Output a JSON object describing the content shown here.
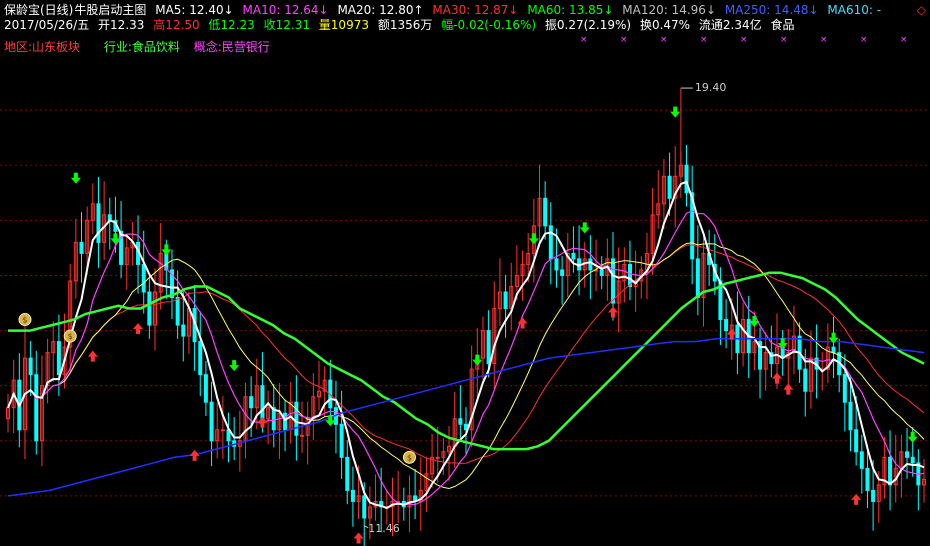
{
  "header": {
    "title": "保龄宝(日线)",
    "indicator": "牛股启动主图",
    "ma5": "MA5: 12.40↓",
    "ma10": "MA10: 12.64↓",
    "ma20": "MA20: 12.80↑",
    "ma30": "MA30: 12.87↓",
    "ma60": "MA60: 13.85↓",
    "ma120": "MA120: 14.96↓",
    "ma250": "MA250: 14.48↓",
    "ma610": "MA610: -",
    "date": "2017/05/26/五",
    "open": "开12.33",
    "high": "高12.50",
    "low": "低12.23",
    "close": "收12.31",
    "volume": "量10973",
    "amount": "额1356万",
    "change": "幅-0.02(-0.16%)",
    "amplitude": "振0.27(2.19%)",
    "turnover": "换0.47%",
    "float_cap": "流通2.34亿",
    "sector": "食品"
  },
  "tags": {
    "region": "地区:山东板块",
    "industry": "行业:食品饮料",
    "concept": "概念:民营银行"
  },
  "colors": {
    "up": "#ff3030",
    "down": "#ffffff",
    "ma5": "#ffffff",
    "ma10": "#ff40ff",
    "ma20": "#ffff66",
    "ma30": "#ff3030",
    "ma60": "#33ff33",
    "ma120": "#999999",
    "ma250": "#2030ff",
    "buy_arrow": "#ff3030",
    "sell_arrow": "#00ff00",
    "grid": "#8b0000"
  },
  "chart_data": {
    "type": "candlestick",
    "price_max_label": "19.40",
    "price_min_label": "11.46",
    "ylim": [
      11.2,
      20.0
    ],
    "max_value": 19.4,
    "min_value": 11.46,
    "close": [
      13.6,
      14.1,
      13.2,
      14.5,
      14.2,
      13.0,
      14.0,
      14.6,
      14.8,
      14.2,
      14.7,
      15.9,
      16.6,
      16.4,
      17.0,
      17.3,
      16.6,
      17.1,
      17.0,
      16.8,
      16.2,
      16.5,
      16.6,
      16.2,
      15.7,
      15.1,
      15.7,
      16.4,
      16.1,
      15.6,
      15.1,
      14.9,
      15.4,
      14.8,
      14.2,
      13.7,
      13.0,
      13.2,
      13.2,
      13.0,
      12.9,
      13.0,
      13.8,
      13.6,
      14.0,
      13.4,
      13.6,
      13.2,
      13.5,
      13.2,
      13.7,
      13.1,
      13.1,
      13.4,
      13.8,
      13.9,
      14.1,
      13.6,
      13.3,
      12.7,
      12.1,
      11.9,
      12.0,
      11.6,
      11.8,
      11.9,
      11.8,
      11.8,
      11.9,
      11.9,
      11.8,
      12.0,
      11.9,
      12.1,
      12.4,
      12.7,
      12.7,
      12.8,
      12.9,
      13.4,
      13.3,
      13.2,
      14.3,
      14.5,
      15.0,
      14.4,
      15.4,
      15.7,
      15.4,
      15.8,
      16.0,
      16.2,
      16.4,
      16.9,
      17.4,
      16.9,
      16.3,
      16.1,
      16.0,
      16.4,
      16.3,
      16.1,
      16.3,
      16.1,
      16.1,
      16.0,
      16.3,
      15.5,
      15.9,
      16.2,
      15.8,
      15.9,
      16.1,
      16.4,
      17.1,
      17.3,
      17.8,
      17.4,
      17.8,
      18.0,
      17.5,
      16.3,
      15.6,
      16.4,
      16.2,
      15.9,
      15.2,
      15.0,
      15.1,
      14.6,
      15.2,
      14.6,
      14.8,
      14.3,
      14.6,
      14.4,
      14.7,
      14.5,
      14.6,
      14.9,
      14.3,
      13.9,
      14.5,
      14.3,
      14.3,
      14.7,
      14.6,
      14.2,
      13.7,
      13.2,
      12.8,
      12.5,
      12.1,
      11.9,
      12.2,
      12.7,
      12.2,
      12.5,
      12.8,
      12.7,
      12.6,
      12.2,
      12.3
    ],
    "ma60": [
      15.0,
      15.0,
      15.0,
      15.05,
      15.1,
      15.15,
      15.2,
      15.3,
      15.35,
      15.4,
      15.45,
      15.4,
      15.4,
      15.5,
      15.6,
      15.65,
      15.75,
      15.8,
      15.8,
      15.7,
      15.6,
      15.4,
      15.3,
      15.2,
      15.1,
      14.95,
      14.85,
      14.7,
      14.55,
      14.4,
      14.3,
      14.2,
      14.1,
      13.95,
      13.8,
      13.7,
      13.55,
      13.4,
      13.3,
      13.15,
      13.05,
      13.0,
      12.95,
      12.9,
      12.85,
      12.85,
      12.85,
      12.85,
      12.9,
      13.0,
      13.2,
      13.4,
      13.6,
      13.8,
      14.0,
      14.2,
      14.4,
      14.6,
      14.8,
      15.0,
      15.2,
      15.4,
      15.55,
      15.7,
      15.75,
      15.85,
      15.9,
      15.95,
      16.0,
      16.05,
      16.05,
      16.0,
      15.95,
      15.85,
      15.75,
      15.6,
      15.4,
      15.2,
      15.05,
      14.9,
      14.75,
      14.6,
      14.5,
      14.4
    ],
    "ma250": [
      12.0,
      12.05,
      12.1,
      12.2,
      12.3,
      12.4,
      12.5,
      12.6,
      12.7,
      12.75,
      12.85,
      12.95,
      13.05,
      13.15,
      13.25,
      13.35,
      13.5,
      13.6,
      13.7,
      13.8,
      13.9,
      14.0,
      14.1,
      14.2,
      14.3,
      14.4,
      14.5,
      14.55,
      14.6,
      14.65,
      14.7,
      14.75,
      14.8,
      14.8,
      14.85,
      14.85,
      14.85,
      14.85,
      14.85,
      14.8,
      14.8,
      14.75,
      14.7,
      14.65,
      14.6
    ],
    "sell_signals": [
      {
        "i": 12,
        "v": 17.7
      },
      {
        "i": 19,
        "v": 16.6
      },
      {
        "i": 28,
        "v": 16.4
      },
      {
        "i": 40,
        "v": 14.3
      },
      {
        "i": 57,
        "v": 13.3
      },
      {
        "i": 83,
        "v": 14.4
      },
      {
        "i": 93,
        "v": 16.6
      },
      {
        "i": 102,
        "v": 16.8
      },
      {
        "i": 118,
        "v": 18.9
      },
      {
        "i": 132,
        "v": 15.1
      },
      {
        "i": 137,
        "v": 14.7
      },
      {
        "i": 146,
        "v": 14.8
      },
      {
        "i": 160,
        "v": 13.0
      }
    ],
    "buy_signals": [
      {
        "i": 15,
        "v": 14.6
      },
      {
        "i": 23,
        "v": 15.1
      },
      {
        "i": 33,
        "v": 12.8
      },
      {
        "i": 45,
        "v": 13.4
      },
      {
        "i": 62,
        "v": 11.3
      },
      {
        "i": 91,
        "v": 15.2
      },
      {
        "i": 107,
        "v": 15.4
      },
      {
        "i": 128,
        "v": 15.0
      },
      {
        "i": 136,
        "v": 14.2
      },
      {
        "i": 138,
        "v": 14.0
      },
      {
        "i": 150,
        "v": 12.0
      }
    ],
    "money_bags": [
      {
        "i": 3,
        "v": 15.2
      },
      {
        "i": 11,
        "v": 14.9
      },
      {
        "i": 71,
        "v": 12.7
      }
    ],
    "top_markers_count": 9
  }
}
